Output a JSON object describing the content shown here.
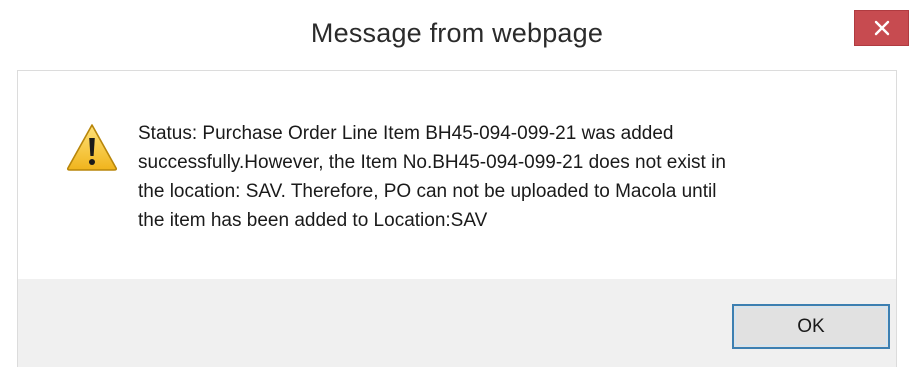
{
  "window": {
    "title": "Message from webpage",
    "close_label": "×"
  },
  "dialog": {
    "icon": "warning-icon",
    "message": "Status: Purchase Order Line Item BH45-094-099-21 was added\nsuccessfully.However, the Item No.BH45-094-099-21 does not exist in\nthe location: SAV. Therefore, PO can not be uploaded to Macola  until\nthe item has been added to Location:SAV"
  },
  "buttons": {
    "ok_label": "OK"
  },
  "colors": {
    "close_button": "#c74b50",
    "ok_border": "#3c7fb1",
    "warning_fill": "#f5c22f"
  }
}
